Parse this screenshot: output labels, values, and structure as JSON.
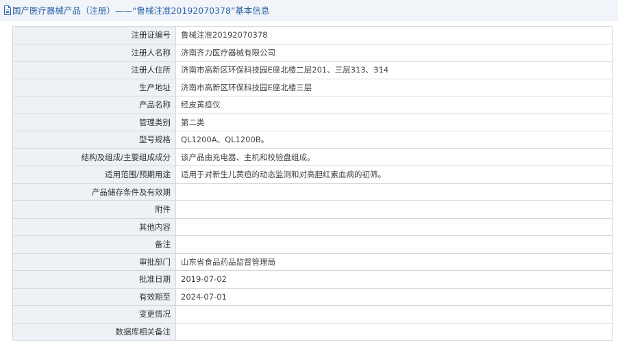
{
  "header": {
    "icon": "document-icon",
    "title": "国产医疗器械产品（注册）——“鲁械注准20192070378”基本信息"
  },
  "colors": {
    "title_text": "#2a64a8",
    "header_bg": "#f1f4f8",
    "label_bg": "#eef2f7",
    "border": "#d6d6d6"
  },
  "rows": [
    {
      "label": "注册证编号",
      "value": "鲁械注准20192070378"
    },
    {
      "label": "注册人名称",
      "value": "济南齐力医疗器械有限公司"
    },
    {
      "label": "注册人住所",
      "value": "济南市高新区环保科技园E座北楼二层201、三层313、314"
    },
    {
      "label": "生产地址",
      "value": "济南市高新区环保科技园E座北楼三层"
    },
    {
      "label": "产品名称",
      "value": "经皮黄疸仪"
    },
    {
      "label": "管理类别",
      "value": "第二类"
    },
    {
      "label": "型号规格",
      "value": "QL1200A、QL1200B。"
    },
    {
      "label": "结构及组成/主要组成成分",
      "value": "该产品由充电器、主机和校验盘组成。"
    },
    {
      "label": "适用范围/预期用途",
      "value": "适用于对新生儿黄疸的动态监测和对高胆红素血病的初筛。"
    },
    {
      "label": "产品储存条件及有效期",
      "value": ""
    },
    {
      "label": "附件",
      "value": ""
    },
    {
      "label": "其他内容",
      "value": ""
    },
    {
      "label": "备注",
      "value": ""
    },
    {
      "label": "审批部门",
      "value": "山东省食品药品监督管理局"
    },
    {
      "label": "批准日期",
      "value": "2019-07-02"
    },
    {
      "label": "有效期至",
      "value": "2024-07-01"
    },
    {
      "label": "变更情况",
      "value": ""
    },
    {
      "label": "数据库相关备注",
      "value": ""
    }
  ]
}
